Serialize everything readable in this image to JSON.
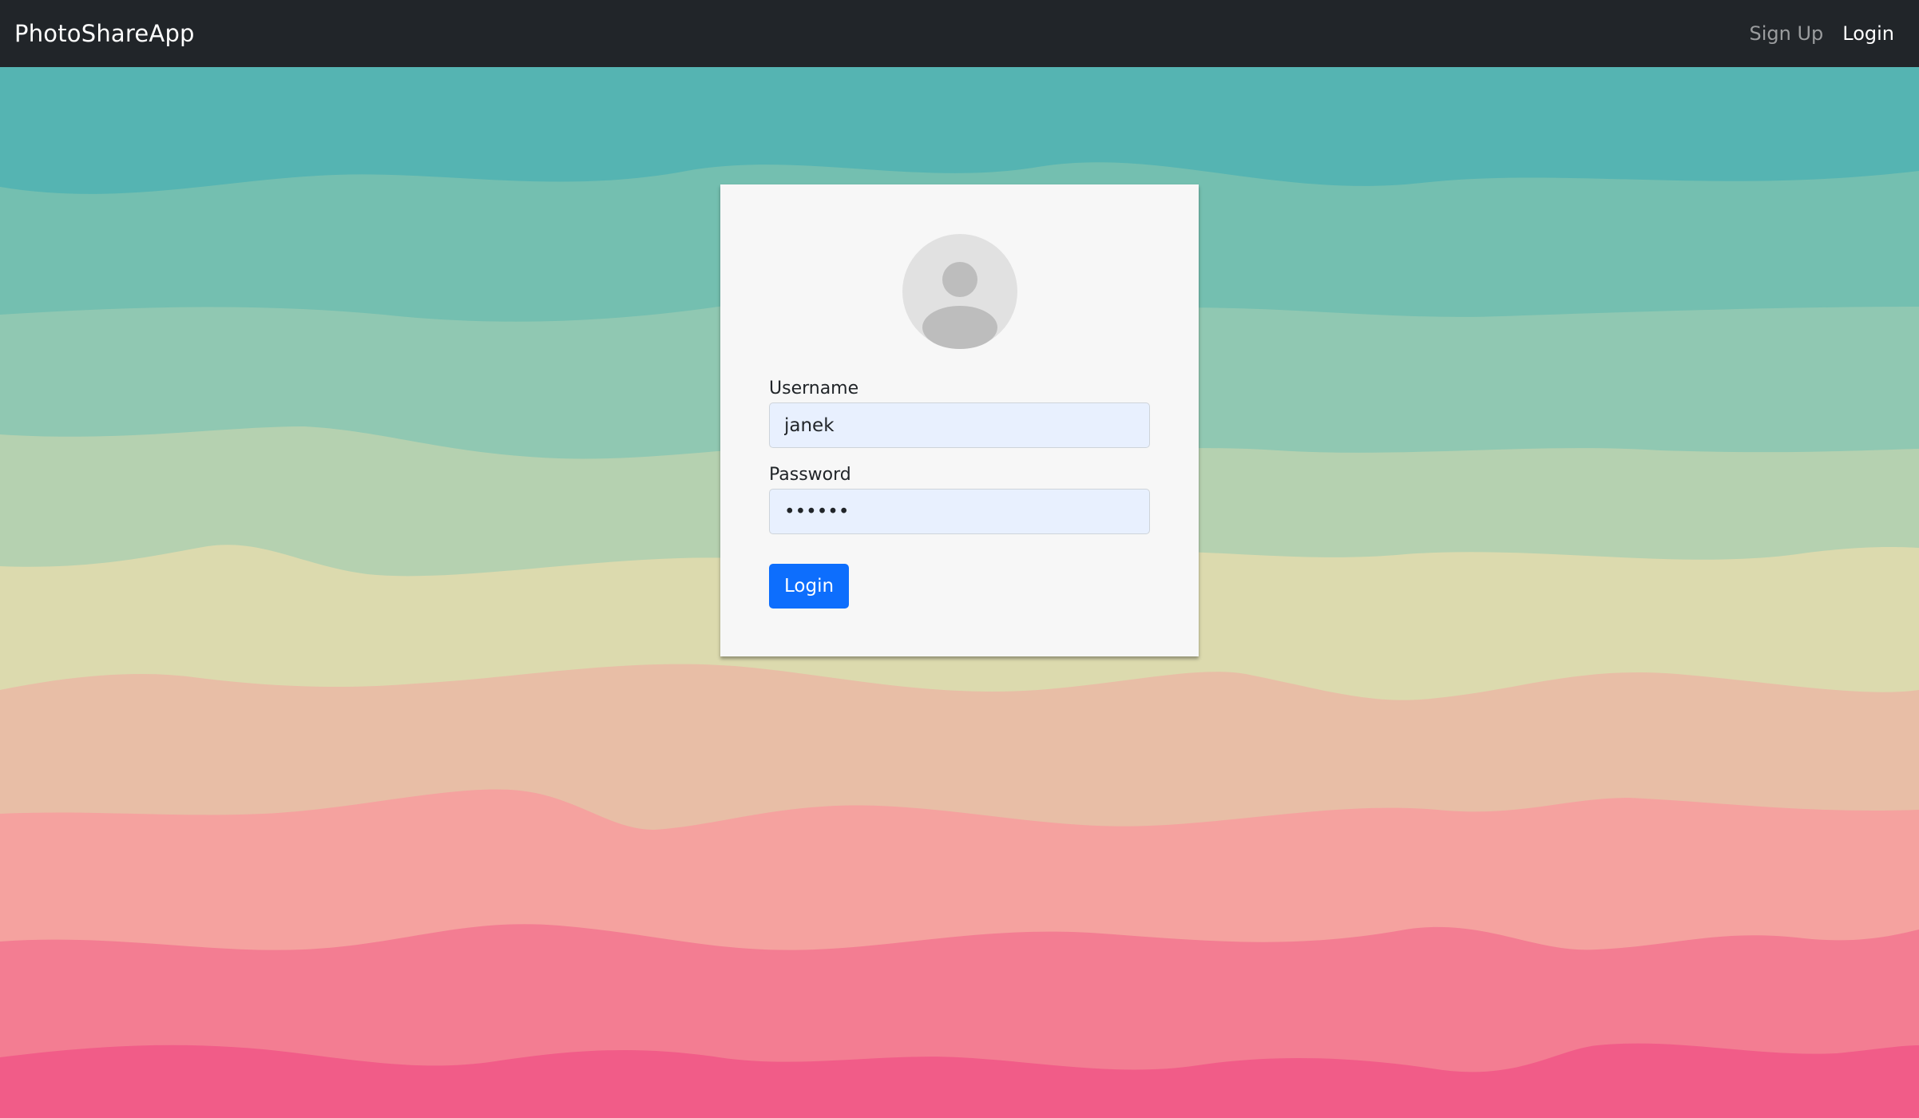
{
  "navbar": {
    "brand": "PhotoShareApp",
    "links": [
      {
        "label": "Sign Up",
        "active": false
      },
      {
        "label": "Login",
        "active": true
      }
    ]
  },
  "login_form": {
    "username_label": "Username",
    "username_value": "janek",
    "password_label": "Password",
    "password_value": "••••••",
    "submit_label": "Login"
  },
  "avatar": {
    "icon": "user-placeholder-icon"
  },
  "colors": {
    "navbar_bg": "#212529",
    "card_bg": "#f7f7f7",
    "input_bg": "#e8f0fe",
    "button_bg": "#0d6efd",
    "wave_bands": [
      "#55b4b2",
      "#74bfb0",
      "#90c8b2",
      "#b5d1b0",
      "#dcdaae",
      "#e8bea6",
      "#f5a29f",
      "#f37d92",
      "#f15c88"
    ]
  }
}
